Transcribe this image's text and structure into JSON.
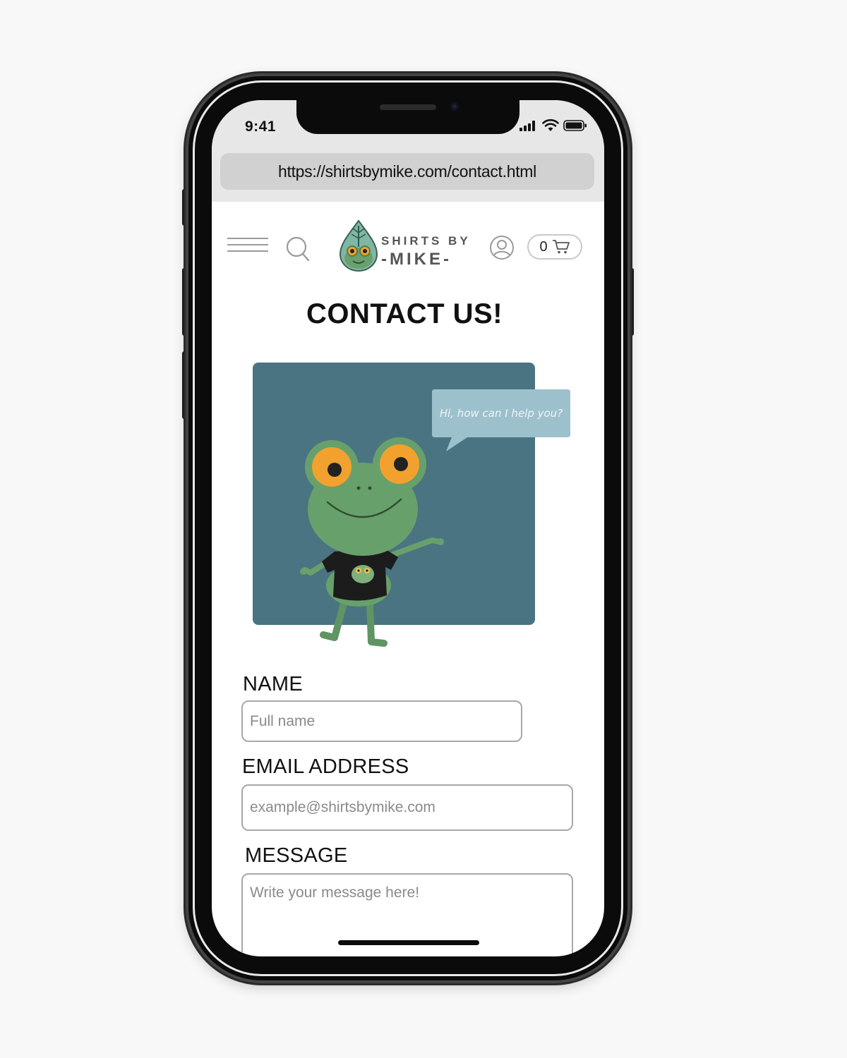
{
  "status_bar": {
    "time": "9:41",
    "icons": [
      "signal-icon",
      "wifi-icon",
      "battery-icon"
    ]
  },
  "browser": {
    "url": "https://shirtsbymike.com/contact.html"
  },
  "header": {
    "logo_top": "SHIRTS BY",
    "logo_bottom": "-MIKE-",
    "cart_count": "0",
    "icons": [
      "menu-icon",
      "search-icon",
      "user-icon",
      "cart-icon"
    ]
  },
  "page": {
    "title": "CONTACT US!"
  },
  "illustration": {
    "speech_bubble": "Hi, how can I help you?",
    "colors": {
      "panel": "#4a7482",
      "bubble": "#9dc1cc",
      "frog": "#68a06c",
      "eye": "#f2a12e",
      "shirt": "#1c1c1c"
    }
  },
  "form": {
    "name_label": "NAME",
    "name_placeholder": "Full name",
    "email_label": "EMAIL ADDRESS",
    "email_placeholder": "example@shirtsbymike.com",
    "message_label": "MESSAGE",
    "message_placeholder": "Write your message here!"
  }
}
